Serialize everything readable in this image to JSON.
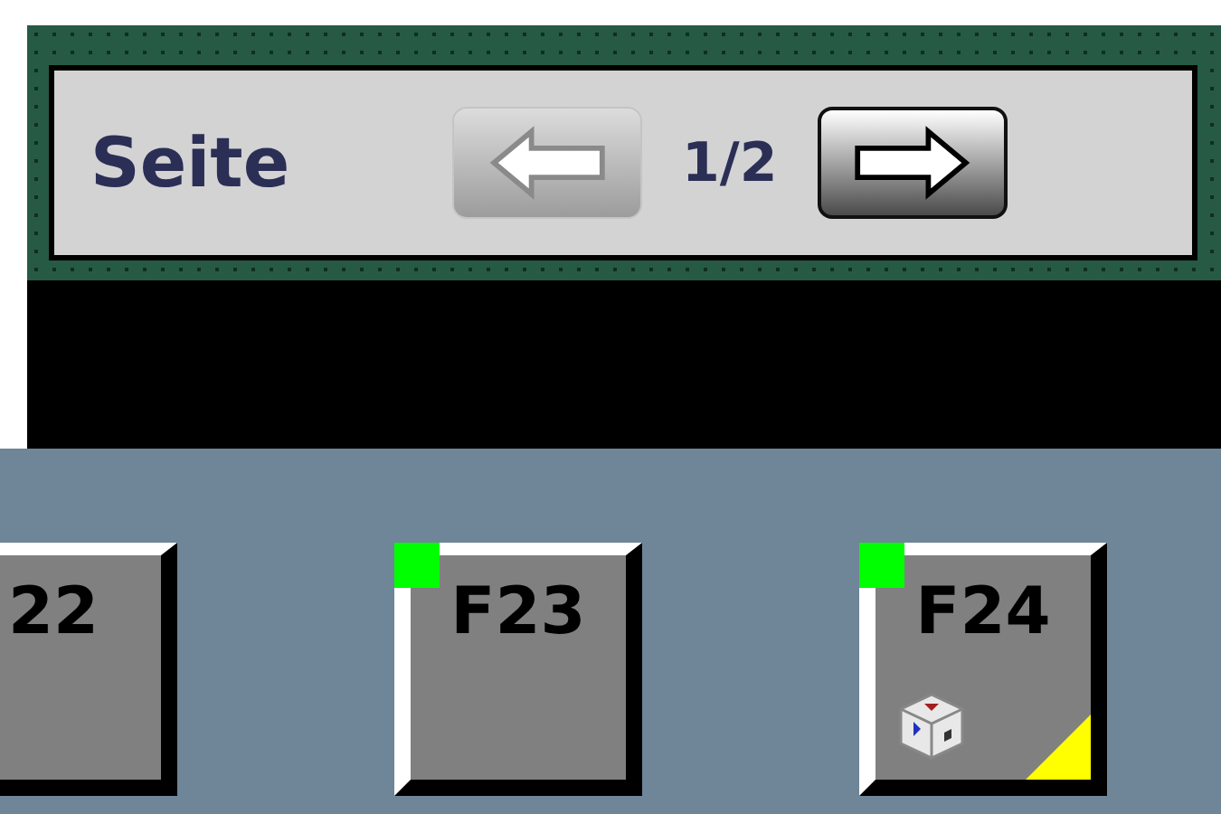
{
  "page_bar": {
    "label": "Seite",
    "prev_button": {
      "disabled": true
    },
    "page": "1/2",
    "next_button": {
      "disabled": false
    }
  },
  "function_keys": [
    {
      "label": "22",
      "has_object": false
    },
    {
      "label": "F23",
      "led": true,
      "has_object": false
    },
    {
      "label": "F24",
      "led": true,
      "has_object": true
    }
  ]
}
